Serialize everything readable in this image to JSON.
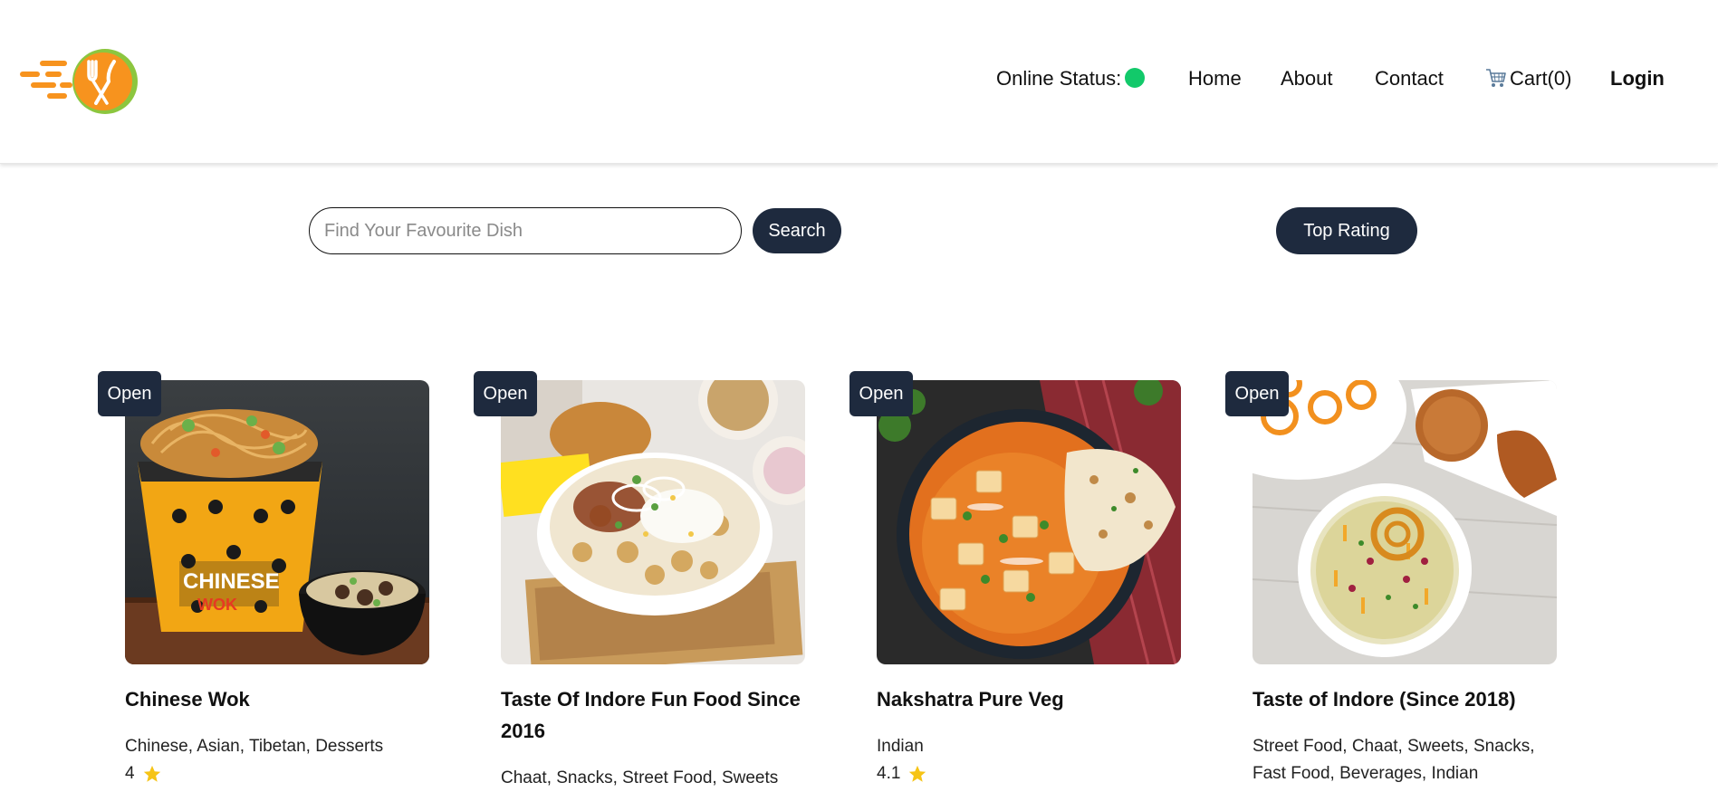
{
  "header": {
    "online_status_label": "Online Status:",
    "online_status_color": "#12c96a",
    "nav": {
      "home": "Home",
      "about": "About",
      "contact": "Contact",
      "cart": "Cart(0)",
      "login": "Login"
    },
    "icons": {
      "logo": "food-delivery-logo",
      "cart": "cart-icon"
    }
  },
  "search": {
    "placeholder": "Find Your Favourite Dish",
    "value": "",
    "button_label": "Search"
  },
  "filter": {
    "top_rating_label": "Top Rating"
  },
  "colors": {
    "button_bg": "#1e2a3e",
    "star": "#f6c416",
    "logo_orange": "#f7931e",
    "logo_green": "#8cc63f"
  },
  "restaurants": [
    {
      "status": "Open",
      "name": "Chinese Wok",
      "cuisines": "Chinese, Asian, Tibetan, Desserts",
      "rating": "4"
    },
    {
      "status": "Open",
      "name": "Taste Of Indore Fun Food Since 2016",
      "cuisines": "Chaat, Snacks, Street Food, Sweets",
      "rating": ""
    },
    {
      "status": "Open",
      "name": "Nakshatra Pure Veg",
      "cuisines": "Indian",
      "rating": "4.1"
    },
    {
      "status": "Open",
      "name": "Taste of Indore (Since 2018)",
      "cuisines": "Street Food, Chaat, Sweets, Snacks, Fast Food, Beverages, Indian",
      "rating": ""
    }
  ]
}
